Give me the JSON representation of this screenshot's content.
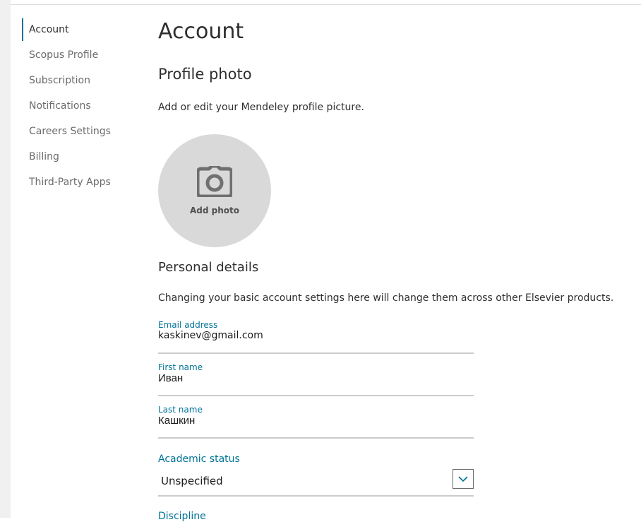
{
  "sidebar": {
    "items": [
      {
        "label": "Account",
        "active": true
      },
      {
        "label": "Scopus Profile"
      },
      {
        "label": "Subscription"
      },
      {
        "label": "Notifications"
      },
      {
        "label": "Careers Settings"
      },
      {
        "label": "Billing"
      },
      {
        "label": "Third-Party Apps"
      }
    ]
  },
  "main": {
    "title": "Account",
    "profile_photo": {
      "heading": "Profile photo",
      "description": "Add or edit your Mendeley profile picture.",
      "add_photo_label": "Add photo",
      "icon": "camera-icon"
    },
    "personal_details": {
      "heading": "Personal details",
      "description": "Changing your basic account settings here will change them across other Elsevier products.",
      "email": {
        "label": "Email address",
        "value": "kaskinev@gmail.com"
      },
      "first_name": {
        "label": "First name",
        "value": "Иван"
      },
      "last_name": {
        "label": "Last name",
        "value": "Кашкин"
      },
      "academic_status": {
        "label": "Academic status",
        "selected": "Unspecified"
      },
      "discipline": {
        "label": "Discipline"
      }
    }
  },
  "colors": {
    "accent": "#007398",
    "text": "#2e2e2e",
    "muted": "#6b6b6b",
    "photo_bg": "#d9d9d9"
  }
}
